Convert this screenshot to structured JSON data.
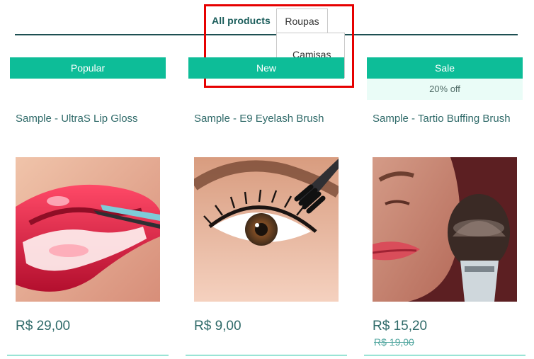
{
  "nav": {
    "all_products": "All products",
    "category": "Roupas",
    "dropdown_items": [
      "Camisas"
    ]
  },
  "products": [
    {
      "badge": "Popular",
      "title": "Sample - UltraS Lip Gloss",
      "price": "R$ 29,00"
    },
    {
      "badge": "New",
      "title": "Sample - E9 Eyelash Brush",
      "price": "R$ 9,00"
    },
    {
      "badge": "Sale",
      "discount": "20% off",
      "title": "Sample - Tartio Buffing Brush",
      "price": "R$ 15,20",
      "old_price": "R$ 19,00"
    }
  ],
  "colors": {
    "accent": "#0dbd98",
    "nav_text": "#1b5d5b",
    "highlight": "#e60000"
  },
  "icons": {
    "lip": "lip-gloss-photo",
    "eye": "eyelash-brush-photo",
    "face": "buffing-brush-photo"
  }
}
